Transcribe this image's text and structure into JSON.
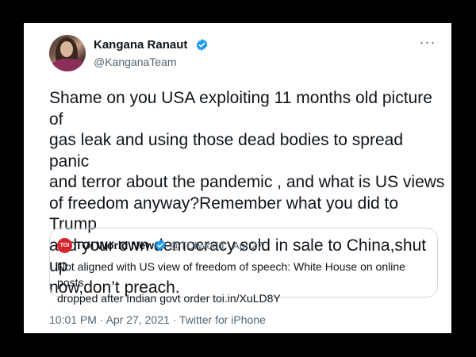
{
  "tweet": {
    "author_name": "Kangana Ranaut",
    "author_handle": "@KanganaTeam",
    "more_icon": "more-horizontal-icon",
    "verified_icon": "verified-badge-icon",
    "text": "Shame on you USA exploiting 11 months old picture of\ngas leak and using those dead bodies to spread panic\nand terror about the pandemic , and what is US views\nof freedom anyway?Remember what you did to Trump\nand your own democracy sold in sale to China,shut up\nnow,don’t preach.",
    "quoted": {
      "logo_text": "TOI",
      "name": "TOI World News",
      "meta": "@TOIWorld · Apr 27",
      "text": "Not aligned with US view of freedom of speech: White House on online posts\ndropped after Indian govt order toi.in/XuLD8Y"
    },
    "footer": "10:01 PM · Apr 27, 2021 · Twitter for iPhone"
  },
  "colors": {
    "verified": "#1d9bf0",
    "toi_logo": "#d7262b",
    "secondary_text": "#536471"
  }
}
